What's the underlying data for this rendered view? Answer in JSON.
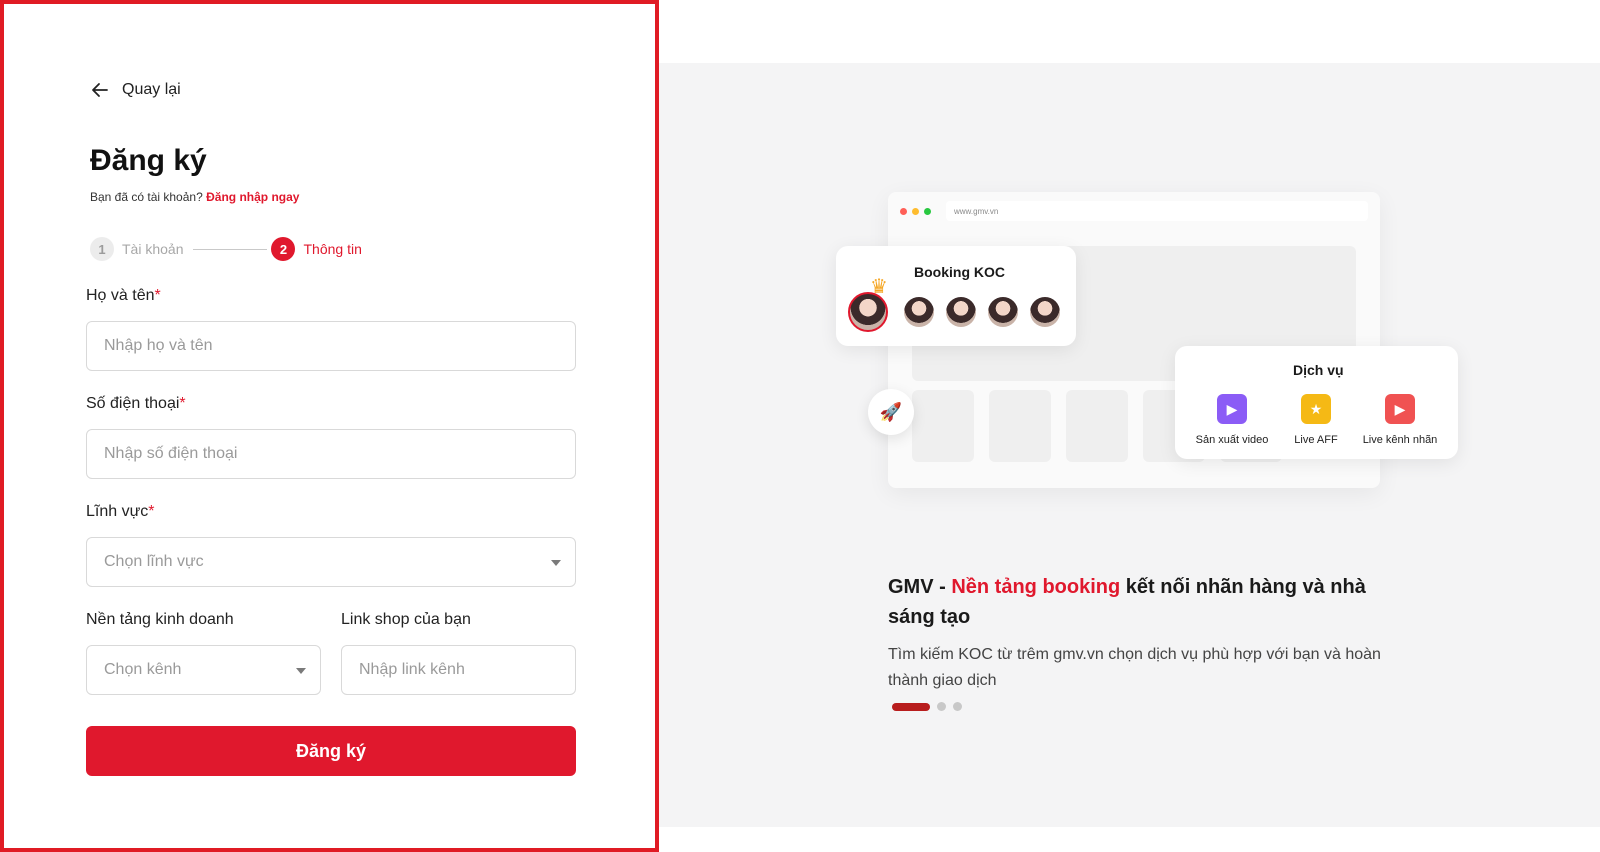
{
  "form": {
    "back_label": "Quay lại",
    "title": "Đăng ký",
    "login_prompt": "Bạn đã có tài khoản?",
    "login_link": "Đăng nhập ngay",
    "steps": [
      {
        "number": "1",
        "label": "Tài khoản",
        "state": "inactive"
      },
      {
        "number": "2",
        "label": "Thông tin",
        "state": "active"
      }
    ],
    "required_mark": "*",
    "fields": {
      "full_name": {
        "label": "Họ và tên",
        "placeholder": "Nhập họ và tên"
      },
      "phone": {
        "label": "Số điện thoại",
        "placeholder": "Nhập số điện thoại"
      },
      "field": {
        "label": "Lĩnh vực",
        "placeholder": "Chọn lĩnh vực"
      },
      "platform": {
        "label": "Nền tảng kinh doanh",
        "placeholder": "Chọn kênh"
      },
      "shop_link": {
        "label": "Link shop của bạn",
        "placeholder": "Nhập link kênh"
      }
    },
    "submit_label": "Đăng ký"
  },
  "showcase": {
    "browser_url": "www.gmv.vn",
    "booking_card_title": "Booking KOC",
    "services_card_title": "Dịch vụ",
    "services": [
      {
        "label": "Sản xuất video",
        "icon": "video-production-icon",
        "color": "#8b5cf6"
      },
      {
        "label": "Live AFF",
        "icon": "star-folder-icon",
        "color": "#f5b915"
      },
      {
        "label": "Live kênh nhãn",
        "icon": "live-camera-icon",
        "color": "#f05252"
      }
    ],
    "headline_prefix": "GMV - ",
    "headline_accent": "Nền tảng booking",
    "headline_suffix": " kết nối nhãn hàng và nhà sáng tạo",
    "subtext": "Tìm kiếm KOC từ trêm gmv.vn chọn dịch vụ phù hợp với bạn và hoàn thành giao dịch",
    "carousel_active_index": 0,
    "carousel_count": 3
  },
  "colors": {
    "brand_red": "#e0182d",
    "panel_bg": "#f4f4f5"
  }
}
